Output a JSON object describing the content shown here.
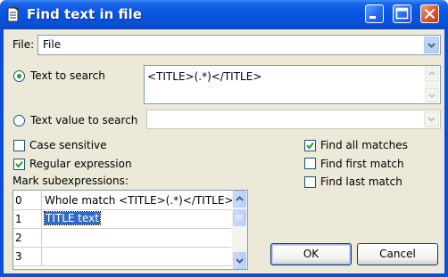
{
  "window": {
    "title": "Find text in file"
  },
  "file": {
    "label": "File:",
    "value": "File"
  },
  "search": {
    "text_option_label": "Text to search",
    "text_value": "<TITLE>(.*)</TITLE>",
    "value_option_label": "Text value to search",
    "value_value": "",
    "selected_option": "Text to search"
  },
  "options": {
    "case_sensitive": {
      "label": "Case sensitive",
      "checked": false
    },
    "regular_expression": {
      "label": "Regular expression",
      "checked": true
    },
    "find_all": {
      "label": "Find all matches",
      "checked": true
    },
    "find_first": {
      "label": "Find first match",
      "checked": false
    },
    "find_last": {
      "label": "Find last match",
      "checked": false
    }
  },
  "subexpressions": {
    "label": "Mark subexpressions:",
    "rows": [
      {
        "index": "0",
        "text": "Whole match <TITLE>(.*)</TITLE>"
      },
      {
        "index": "1",
        "text": "TITLE text"
      },
      {
        "index": "2",
        "text": ""
      },
      {
        "index": "3",
        "text": ""
      }
    ],
    "selected_row": "1"
  },
  "buttons": {
    "ok": "OK",
    "cancel": "Cancel"
  },
  "colors": {
    "title_bar": "#0a4fd6",
    "dialog_bg": "#ece9d8",
    "selection": "#316ac5",
    "check_green": "#21a121"
  },
  "icons": {
    "app": "notepad-icon",
    "minimize": "minimize-icon",
    "maximize": "maximize-icon",
    "close": "close-icon"
  }
}
